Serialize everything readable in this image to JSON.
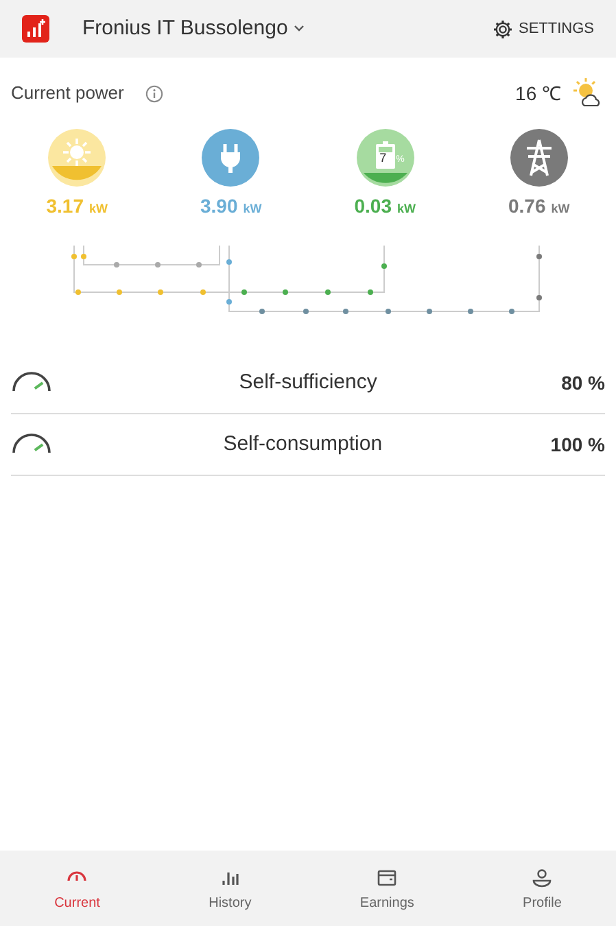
{
  "header": {
    "plant": "Fronius IT Bussolengo",
    "settings": "SETTINGS"
  },
  "power": {
    "title": "Current power",
    "temperature": "16 ℃"
  },
  "nodes": [
    {
      "kind": "solar",
      "color": "#f0c030",
      "value": "3.17",
      "unit": "kW"
    },
    {
      "kind": "load",
      "color": "#6aaed6",
      "value": "3.90",
      "unit": "kW"
    },
    {
      "kind": "battery",
      "color": "#4caf50",
      "value": "0.03",
      "unit": "kW",
      "charge": "7",
      "percent_sign": "%"
    },
    {
      "kind": "grid",
      "color": "#7a7a7a",
      "value": "0.76",
      "unit": "kW"
    }
  ],
  "metrics": [
    {
      "label": "Self-sufficiency",
      "value": "80 %"
    },
    {
      "label": "Self-consumption",
      "value": "100 %"
    }
  ],
  "nav": [
    {
      "kind": "current",
      "label": "Current",
      "selected": true
    },
    {
      "kind": "history",
      "label": "History",
      "selected": false
    },
    {
      "kind": "earnings",
      "label": "Earnings",
      "selected": false
    },
    {
      "kind": "profile",
      "label": "Profile",
      "selected": false
    }
  ]
}
